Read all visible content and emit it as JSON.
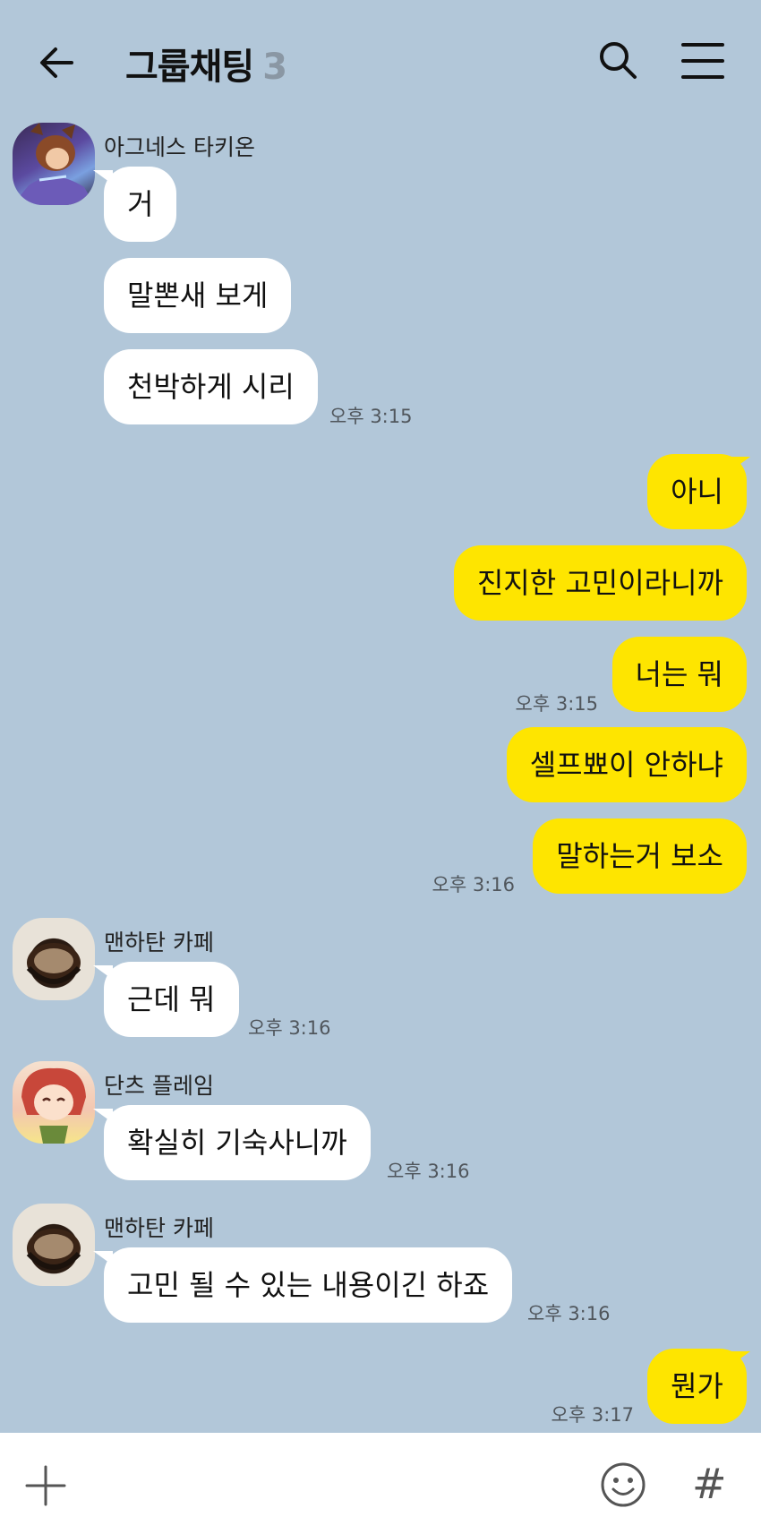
{
  "header": {
    "title": "그룹채팅",
    "count": "3",
    "back_icon": "back-arrow-icon",
    "search_icon": "search-icon",
    "menu_icon": "hamburger-menu-icon"
  },
  "messages": [
    {
      "sender": "아그네스 타키온",
      "text": "거"
    },
    {
      "text": "말뽄새 보게"
    },
    {
      "text": "천박하게 시리",
      "time": "오후 3:15"
    },
    {
      "text": "아니"
    },
    {
      "text": "진지한 고민이라니까"
    },
    {
      "text": "너는 뭐",
      "time": "오후 3:15"
    },
    {
      "text": "셀프뾰이 안하냐"
    },
    {
      "text": "말하는거 보소",
      "time": "오후 3:16"
    },
    {
      "sender": "맨하탄 카페",
      "text": "근데 뭐",
      "time": "오후 3:16"
    },
    {
      "sender": "단츠 플레임",
      "text": "확실히 기숙사니까",
      "time": "오후 3:16"
    },
    {
      "sender": "맨하탄 카페",
      "text": "고민 될 수 있는 내용이긴 하죠",
      "time": "오후 3:16"
    },
    {
      "text": "뭔가",
      "time": "오후 3:17"
    }
  ],
  "input_bar": {
    "plus_icon": "plus-icon",
    "emoji_icon": "emoji-icon",
    "hash_label": "#"
  },
  "colors": {
    "background": "#b2c7d9",
    "outgoing_bubble": "#fee500",
    "incoming_bubble": "#ffffff"
  }
}
